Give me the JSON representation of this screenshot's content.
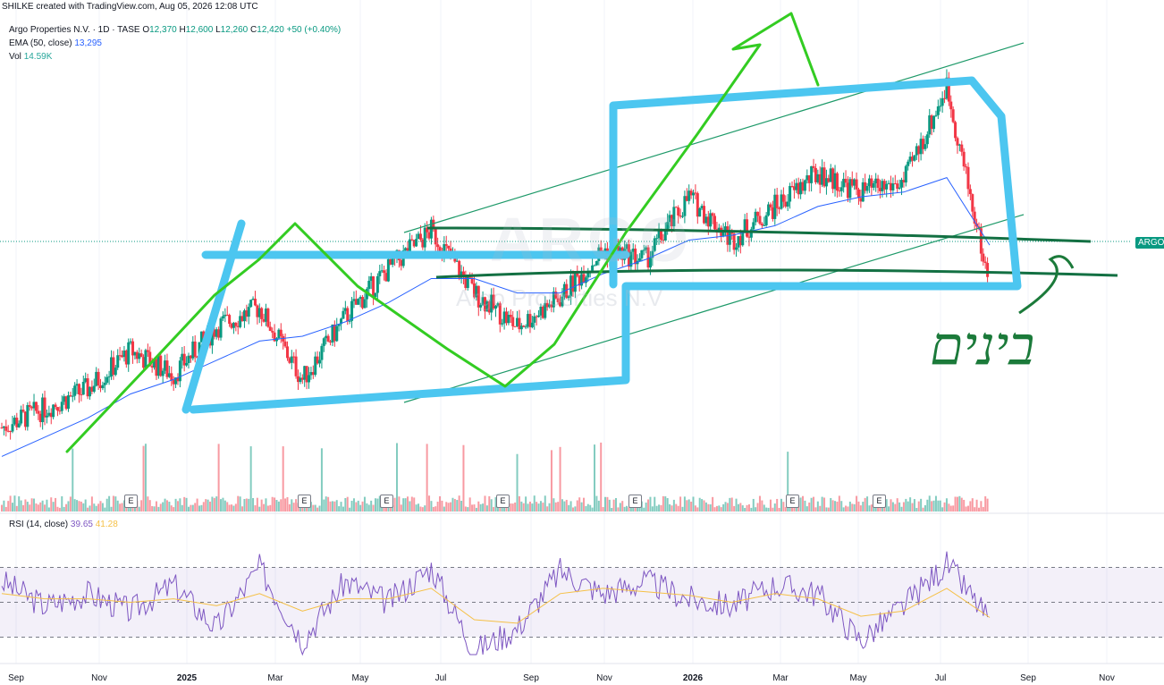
{
  "credit": "SHILKE created with TradingView.com, Aug 05, 2026 12:08 UTC",
  "symbol_line": {
    "name": "Argo Properties N.V. · 1D · TASE",
    "o_label": "O",
    "o": "12,370",
    "h_label": "H",
    "h": "12,600",
    "l_label": "L",
    "l": "12,260",
    "c_label": "C",
    "c": "12,420",
    "change": "+50 (+0.40%)"
  },
  "ema_line": {
    "label": "EMA (50, close)",
    "value": "13,295"
  },
  "vol_line": {
    "label": "Vol",
    "value": "14.59K"
  },
  "rsi_line": {
    "label": "RSI (14, close)",
    "value": "39.65",
    "ma_value": "41.28"
  },
  "price_tag": "ARGO",
  "watermark": {
    "ticker": "ARGO",
    "name": "Argo Properties N.V"
  },
  "annotation_text": "בינים",
  "earnings_marker": "E",
  "colors": {
    "up": "#089981",
    "down": "#f23645",
    "ema": "#2962ff",
    "rsi": "#7e57c2",
    "rsi_ma": "#f5c046",
    "box": "#4cc6f0",
    "swing": "#33cc22",
    "channel": "#1f9a6a",
    "range": "#137043"
  },
  "chart_data": [
    {
      "type": "candlestick",
      "series": [
        {
          "name": "Price",
          "x": [
            "2024-09",
            "2024-10",
            "2024-11",
            "2024-12",
            "2025-01",
            "2025-02",
            "2025-03",
            "2025-04",
            "2025-05",
            "2025-06",
            "2025-07",
            "2025-08",
            "2025-09",
            "2025-10",
            "2025-11",
            "2025-12",
            "2026-01",
            "2026-02",
            "2026-03",
            "2026-04",
            "2026-05",
            "2026-06",
            "2026-07",
            "2026-08"
          ],
          "y": [
            9500,
            9900,
            10300,
            11100,
            10600,
            11600,
            12000,
            10500,
            11800,
            12800,
            13600,
            12300,
            11600,
            12200,
            13200,
            13000,
            14300,
            13400,
            14100,
            14800,
            14400,
            14600,
            16600,
            12420
          ]
        },
        {
          "name": "EMA (50, close)",
          "y": [
            8900,
            9300,
            9700,
            10200,
            10500,
            10900,
            11300,
            11400,
            11700,
            12100,
            12600,
            12600,
            12300,
            12300,
            12700,
            13000,
            13400,
            13500,
            13700,
            14100,
            14300,
            14400,
            14700,
            13295
          ]
        }
      ],
      "x_ticks": [
        "Sep",
        "Nov",
        "2025",
        "Mar",
        "May",
        "Jul",
        "Sep",
        "Nov",
        "2026",
        "Mar",
        "May",
        "Jul",
        "Sep",
        "Nov"
      ],
      "earnings_events": [
        "2024-11",
        "2025-03",
        "2025-05",
        "2025-08",
        "2025-11",
        "2026-03",
        "2026-05"
      ]
    },
    {
      "type": "line",
      "series": [
        {
          "name": "RSI (14, close)",
          "y": [
            62,
            48,
            55,
            45,
            60,
            35,
            70,
            28,
            62,
            50,
            70,
            22,
            35,
            68,
            55,
            62,
            52,
            48,
            60,
            55,
            28,
            48,
            72,
            39.65
          ]
        },
        {
          "name": "RSI MA",
          "y": [
            55,
            52,
            52,
            50,
            52,
            48,
            55,
            45,
            52,
            52,
            58,
            40,
            38,
            55,
            58,
            56,
            54,
            50,
            55,
            52,
            42,
            45,
            58,
            41.28
          ]
        }
      ],
      "levels": [
        70,
        50,
        30
      ]
    }
  ]
}
